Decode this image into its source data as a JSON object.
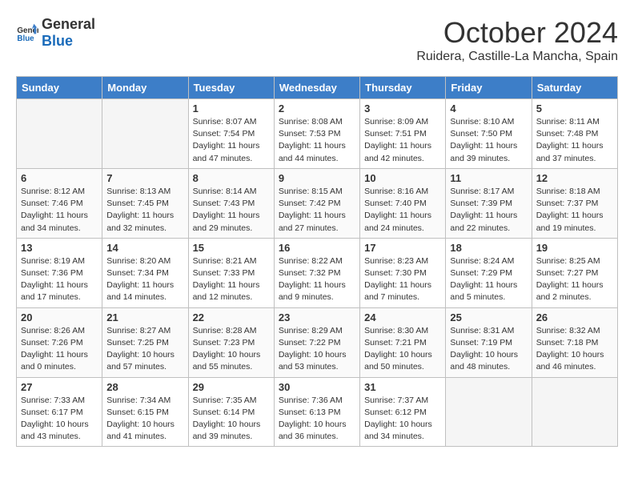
{
  "header": {
    "logo_general": "General",
    "logo_blue": "Blue",
    "title": "October 2024",
    "location": "Ruidera, Castille-La Mancha, Spain"
  },
  "days_of_week": [
    "Sunday",
    "Monday",
    "Tuesday",
    "Wednesday",
    "Thursday",
    "Friday",
    "Saturday"
  ],
  "weeks": [
    [
      {
        "day": "",
        "info": ""
      },
      {
        "day": "",
        "info": ""
      },
      {
        "day": "1",
        "info": "Sunrise: 8:07 AM\nSunset: 7:54 PM\nDaylight: 11 hours and 47 minutes."
      },
      {
        "day": "2",
        "info": "Sunrise: 8:08 AM\nSunset: 7:53 PM\nDaylight: 11 hours and 44 minutes."
      },
      {
        "day": "3",
        "info": "Sunrise: 8:09 AM\nSunset: 7:51 PM\nDaylight: 11 hours and 42 minutes."
      },
      {
        "day": "4",
        "info": "Sunrise: 8:10 AM\nSunset: 7:50 PM\nDaylight: 11 hours and 39 minutes."
      },
      {
        "day": "5",
        "info": "Sunrise: 8:11 AM\nSunset: 7:48 PM\nDaylight: 11 hours and 37 minutes."
      }
    ],
    [
      {
        "day": "6",
        "info": "Sunrise: 8:12 AM\nSunset: 7:46 PM\nDaylight: 11 hours and 34 minutes."
      },
      {
        "day": "7",
        "info": "Sunrise: 8:13 AM\nSunset: 7:45 PM\nDaylight: 11 hours and 32 minutes."
      },
      {
        "day": "8",
        "info": "Sunrise: 8:14 AM\nSunset: 7:43 PM\nDaylight: 11 hours and 29 minutes."
      },
      {
        "day": "9",
        "info": "Sunrise: 8:15 AM\nSunset: 7:42 PM\nDaylight: 11 hours and 27 minutes."
      },
      {
        "day": "10",
        "info": "Sunrise: 8:16 AM\nSunset: 7:40 PM\nDaylight: 11 hours and 24 minutes."
      },
      {
        "day": "11",
        "info": "Sunrise: 8:17 AM\nSunset: 7:39 PM\nDaylight: 11 hours and 22 minutes."
      },
      {
        "day": "12",
        "info": "Sunrise: 8:18 AM\nSunset: 7:37 PM\nDaylight: 11 hours and 19 minutes."
      }
    ],
    [
      {
        "day": "13",
        "info": "Sunrise: 8:19 AM\nSunset: 7:36 PM\nDaylight: 11 hours and 17 minutes."
      },
      {
        "day": "14",
        "info": "Sunrise: 8:20 AM\nSunset: 7:34 PM\nDaylight: 11 hours and 14 minutes."
      },
      {
        "day": "15",
        "info": "Sunrise: 8:21 AM\nSunset: 7:33 PM\nDaylight: 11 hours and 12 minutes."
      },
      {
        "day": "16",
        "info": "Sunrise: 8:22 AM\nSunset: 7:32 PM\nDaylight: 11 hours and 9 minutes."
      },
      {
        "day": "17",
        "info": "Sunrise: 8:23 AM\nSunset: 7:30 PM\nDaylight: 11 hours and 7 minutes."
      },
      {
        "day": "18",
        "info": "Sunrise: 8:24 AM\nSunset: 7:29 PM\nDaylight: 11 hours and 5 minutes."
      },
      {
        "day": "19",
        "info": "Sunrise: 8:25 AM\nSunset: 7:27 PM\nDaylight: 11 hours and 2 minutes."
      }
    ],
    [
      {
        "day": "20",
        "info": "Sunrise: 8:26 AM\nSunset: 7:26 PM\nDaylight: 11 hours and 0 minutes."
      },
      {
        "day": "21",
        "info": "Sunrise: 8:27 AM\nSunset: 7:25 PM\nDaylight: 10 hours and 57 minutes."
      },
      {
        "day": "22",
        "info": "Sunrise: 8:28 AM\nSunset: 7:23 PM\nDaylight: 10 hours and 55 minutes."
      },
      {
        "day": "23",
        "info": "Sunrise: 8:29 AM\nSunset: 7:22 PM\nDaylight: 10 hours and 53 minutes."
      },
      {
        "day": "24",
        "info": "Sunrise: 8:30 AM\nSunset: 7:21 PM\nDaylight: 10 hours and 50 minutes."
      },
      {
        "day": "25",
        "info": "Sunrise: 8:31 AM\nSunset: 7:19 PM\nDaylight: 10 hours and 48 minutes."
      },
      {
        "day": "26",
        "info": "Sunrise: 8:32 AM\nSunset: 7:18 PM\nDaylight: 10 hours and 46 minutes."
      }
    ],
    [
      {
        "day": "27",
        "info": "Sunrise: 7:33 AM\nSunset: 6:17 PM\nDaylight: 10 hours and 43 minutes."
      },
      {
        "day": "28",
        "info": "Sunrise: 7:34 AM\nSunset: 6:15 PM\nDaylight: 10 hours and 41 minutes."
      },
      {
        "day": "29",
        "info": "Sunrise: 7:35 AM\nSunset: 6:14 PM\nDaylight: 10 hours and 39 minutes."
      },
      {
        "day": "30",
        "info": "Sunrise: 7:36 AM\nSunset: 6:13 PM\nDaylight: 10 hours and 36 minutes."
      },
      {
        "day": "31",
        "info": "Sunrise: 7:37 AM\nSunset: 6:12 PM\nDaylight: 10 hours and 34 minutes."
      },
      {
        "day": "",
        "info": ""
      },
      {
        "day": "",
        "info": ""
      }
    ]
  ]
}
